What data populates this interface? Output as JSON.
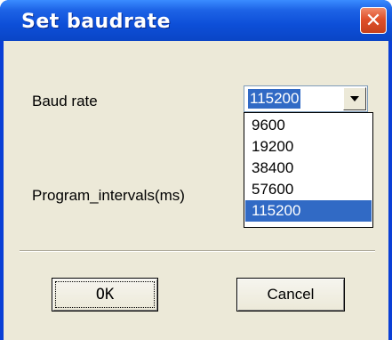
{
  "window": {
    "title": "Set baudrate",
    "close_symbol": "✕"
  },
  "form": {
    "baud_label": "Baud rate",
    "interval_label": "Program_intervals(ms)",
    "baud_selected": "115200",
    "baud_options": [
      "9600",
      "19200",
      "38400",
      "57600",
      "115200"
    ]
  },
  "buttons": {
    "ok": "OK",
    "cancel": "Cancel"
  },
  "colors": {
    "title_bar": "#0d4fd8",
    "dialog_face": "#ece9d8",
    "selection": "#316ac5",
    "close_button": "#e0502a"
  }
}
